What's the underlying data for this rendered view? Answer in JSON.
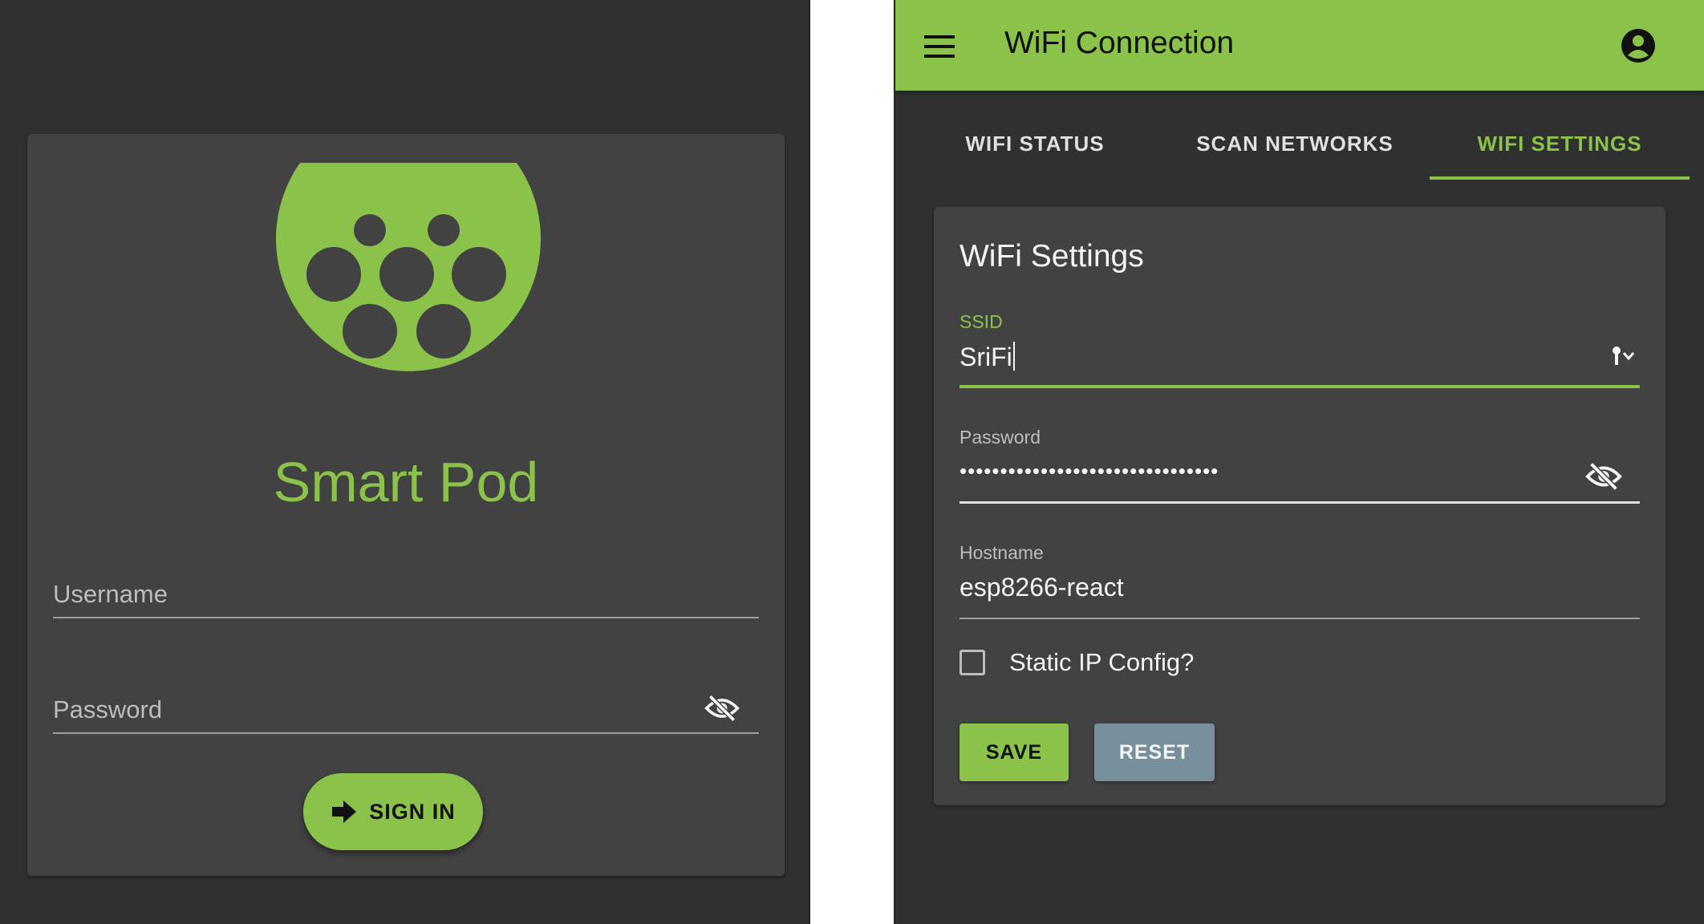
{
  "colors": {
    "accent": "#8bc34a",
    "background": "#303030",
    "surface": "#424242",
    "reset": "#78909c"
  },
  "login": {
    "app_title": "Smart Pod",
    "username_label": "Username",
    "password_label": "Password",
    "signin_label": "SIGN IN",
    "icons": [
      "smart-pod-logo",
      "eye-off-icon",
      "arrow-right-icon"
    ]
  },
  "wifi": {
    "app_bar": {
      "title": "WiFi Connection",
      "icons": [
        "menu-icon",
        "account-circle-icon"
      ]
    },
    "tabs": [
      {
        "label": "WIFI STATUS",
        "selected": false
      },
      {
        "label": "SCAN NETWORKS",
        "selected": false
      },
      {
        "label": "WIFI SETTINGS",
        "selected": true
      }
    ],
    "settings": {
      "title": "WiFi Settings",
      "ssid": {
        "label": "SSID",
        "value": "SriFi"
      },
      "password": {
        "label": "Password",
        "masked_value": "••••••••••••••••••••••••••••••••"
      },
      "hostname": {
        "label": "Hostname",
        "value": "esp8266-react"
      },
      "static_ip": {
        "label": "Static IP Config?",
        "checked": false
      },
      "save_label": "SAVE",
      "reset_label": "RESET"
    }
  }
}
